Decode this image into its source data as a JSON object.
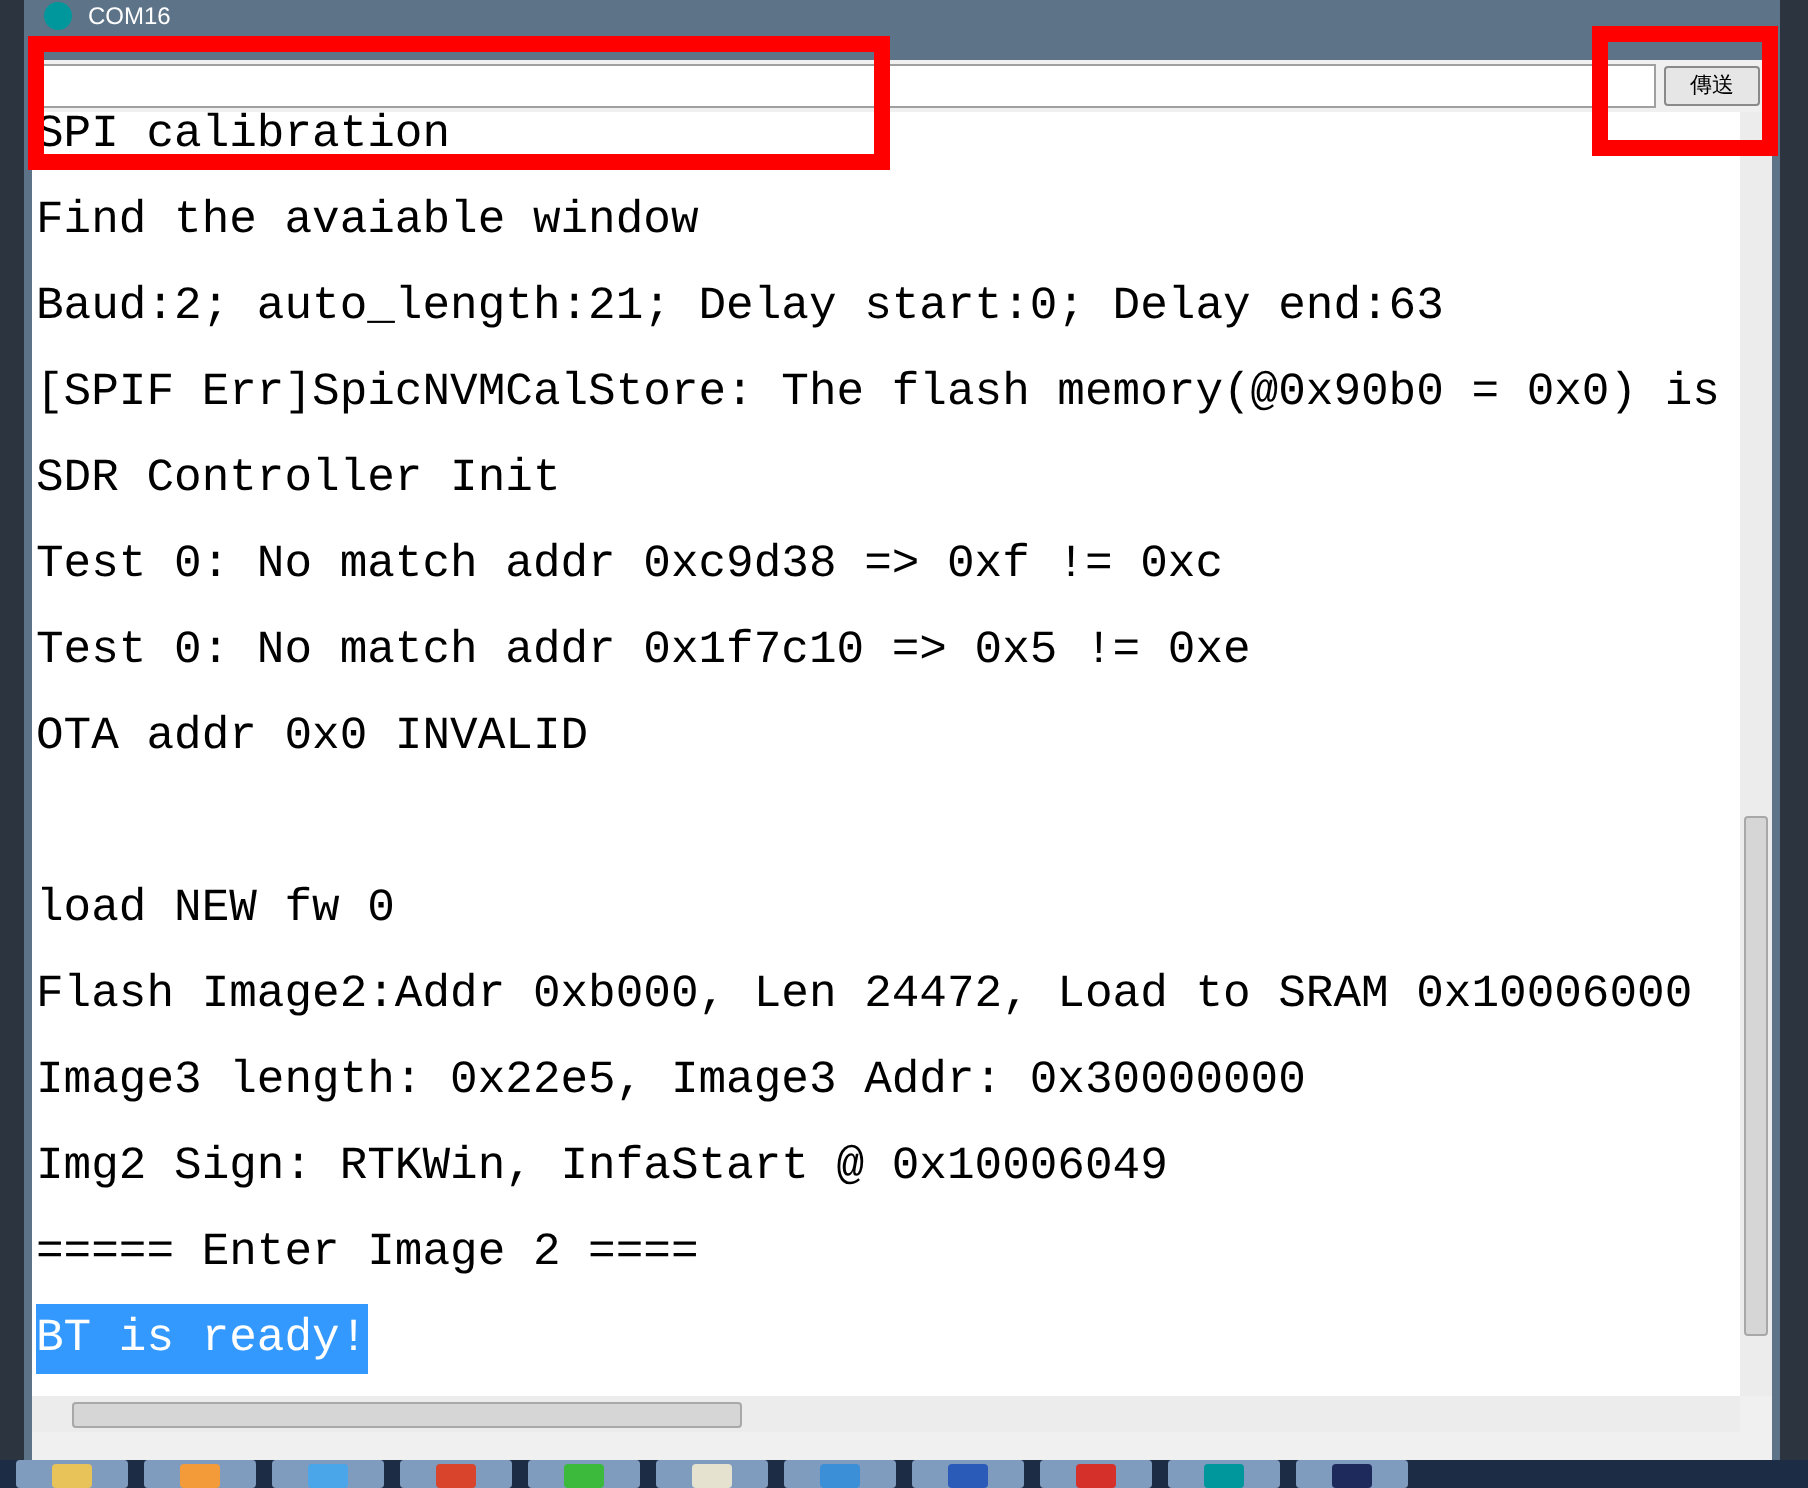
{
  "window": {
    "title": "COM16"
  },
  "send_button": {
    "label": "傳送"
  },
  "output_lines": [
    {
      "kind": "text",
      "text": "SPI calibration",
      "selected": false
    },
    {
      "kind": "text",
      "text": "Find the avaiable window",
      "selected": false
    },
    {
      "kind": "text",
      "text": "Baud:2; auto_length:21; Delay start:0; Delay end:63",
      "selected": false
    },
    {
      "kind": "text",
      "text": "[SPIF Err]SpicNVMCalStore: The flash memory(@0x90b0 = 0x0) is",
      "selected": false
    },
    {
      "kind": "text",
      "text": "SDR Controller Init",
      "selected": false
    },
    {
      "kind": "text",
      "text": "Test 0: No match addr 0xc9d38 => 0xf != 0xc",
      "selected": false
    },
    {
      "kind": "text",
      "text": "Test 0: No match addr 0x1f7c10 => 0x5 != 0xe",
      "selected": false
    },
    {
      "kind": "text",
      "text": "OTA addr 0x0 INVALID",
      "selected": false
    },
    {
      "kind": "blank"
    },
    {
      "kind": "text",
      "text": "load NEW fw 0",
      "selected": false
    },
    {
      "kind": "text",
      "text": "Flash Image2:Addr 0xb000, Len 24472, Load to SRAM 0x10006000",
      "selected": false
    },
    {
      "kind": "text",
      "text": "Image3 length: 0x22e5, Image3 Addr: 0x30000000",
      "selected": false
    },
    {
      "kind": "text",
      "text": "Img2 Sign: RTKWin, InfaStart @ 0x10006049",
      "selected": false
    },
    {
      "kind": "text",
      "text": "===== Enter Image 2 ====",
      "selected": false
    },
    {
      "kind": "text",
      "text": "BT is ready!",
      "selected": true
    }
  ]
}
